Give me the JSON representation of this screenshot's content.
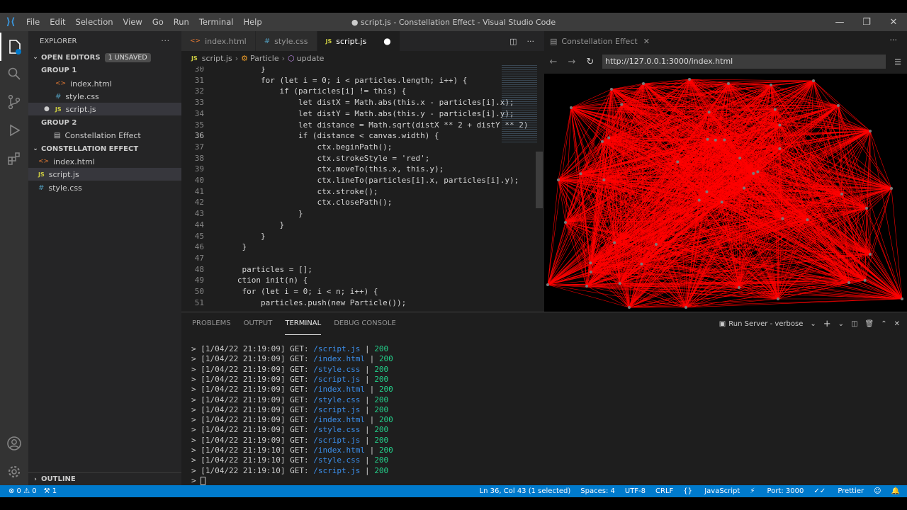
{
  "window": {
    "title": "● script.js - Constellation Effect - Visual Studio Code",
    "menu": [
      "File",
      "Edit",
      "Selection",
      "View",
      "Go",
      "Run",
      "Terminal",
      "Help"
    ]
  },
  "sidebar": {
    "title": "EXPLORER",
    "open_editors": "OPEN EDITORS",
    "unsaved_badge": "1 UNSAVED",
    "group1": "GROUP 1",
    "group1_files": [
      "index.html",
      "style.css",
      "script.js"
    ],
    "group2": "GROUP 2",
    "group2_files": [
      "Constellation Effect"
    ],
    "project": "CONSTELLATION EFFECT",
    "project_files": [
      "index.html",
      "script.js",
      "style.css"
    ],
    "outline": "OUTLINE"
  },
  "editor": {
    "tabs": [
      "index.html",
      "style.css",
      "script.js"
    ],
    "active_tab": "script.js",
    "breadcrumb": [
      "script.js",
      "Particle",
      "update"
    ],
    "lines": [
      {
        "n": "30",
        "t": "        }"
      },
      {
        "n": "31",
        "t": "        for (let i = 0; i < particles.length; i++) {"
      },
      {
        "n": "32",
        "t": "            if (particles[i] != this) {"
      },
      {
        "n": "33",
        "t": "                let distX = Math.abs(this.x - particles[i].x);"
      },
      {
        "n": "34",
        "t": "                let distY = Math.abs(this.y - particles[i].y);"
      },
      {
        "n": "35",
        "t": "                let distance = Math.sqrt(distX ** 2 + distY ** 2)"
      },
      {
        "n": "36",
        "t": "                if (distance < canvas.width) {"
      },
      {
        "n": "37",
        "t": "                    ctx.beginPath();"
      },
      {
        "n": "38",
        "t": "                    ctx.strokeStyle = 'red';"
      },
      {
        "n": "39",
        "t": "                    ctx.moveTo(this.x, this.y);"
      },
      {
        "n": "40",
        "t": "                    ctx.lineTo(particles[i].x, particles[i].y);"
      },
      {
        "n": "41",
        "t": "                    ctx.stroke();"
      },
      {
        "n": "42",
        "t": "                    ctx.closePath();"
      },
      {
        "n": "43",
        "t": "                }"
      },
      {
        "n": "44",
        "t": "            }"
      },
      {
        "n": "45",
        "t": "        }"
      },
      {
        "n": "46",
        "t": "    }"
      },
      {
        "n": "47",
        "t": ""
      },
      {
        "n": "48",
        "t": "    particles = [];"
      },
      {
        "n": "49",
        "t": "   ction init(n) {"
      },
      {
        "n": "50",
        "t": "    for (let i = 0; i < n; i++) {"
      },
      {
        "n": "51",
        "t": "        particles.push(new Particle());"
      }
    ]
  },
  "preview": {
    "tab": "Constellation Effect",
    "url": "http://127.0.0.1:3000/index.html"
  },
  "panel": {
    "tabs": [
      "PROBLEMS",
      "OUTPUT",
      "TERMINAL",
      "DEBUG CONSOLE"
    ],
    "active_tab": "TERMINAL",
    "task": "Run Server - verbose",
    "log": [
      {
        "ts": "[1/04/22 21:19:09] GET: ",
        "path": "/script.js",
        "code": "200"
      },
      {
        "ts": "[1/04/22 21:19:09] GET: ",
        "path": "/index.html",
        "code": "200"
      },
      {
        "ts": "[1/04/22 21:19:09] GET: ",
        "path": "/style.css",
        "code": "200"
      },
      {
        "ts": "[1/04/22 21:19:09] GET: ",
        "path": "/script.js",
        "code": "200"
      },
      {
        "ts": "[1/04/22 21:19:09] GET: ",
        "path": "/index.html",
        "code": "200"
      },
      {
        "ts": "[1/04/22 21:19:09] GET: ",
        "path": "/style.css",
        "code": "200"
      },
      {
        "ts": "[1/04/22 21:19:09] GET: ",
        "path": "/script.js",
        "code": "200"
      },
      {
        "ts": "[1/04/22 21:19:09] GET: ",
        "path": "/index.html",
        "code": "200"
      },
      {
        "ts": "[1/04/22 21:19:09] GET: ",
        "path": "/style.css",
        "code": "200"
      },
      {
        "ts": "[1/04/22 21:19:09] GET: ",
        "path": "/script.js",
        "code": "200"
      },
      {
        "ts": "[1/04/22 21:19:10] GET: ",
        "path": "/index.html",
        "code": "200"
      },
      {
        "ts": "[1/04/22 21:19:10] GET: ",
        "path": "/style.css",
        "code": "200"
      },
      {
        "ts": "[1/04/22 21:19:10] GET: ",
        "path": "/script.js",
        "code": "200"
      }
    ]
  },
  "statusbar": {
    "errors": "⊗ 0 ⚠ 0",
    "ports": "1",
    "cursor": "Ln 36, Col 43 (1 selected)",
    "spaces": "Spaces: 4",
    "encoding": "UTF-8",
    "eol": "CRLF",
    "language": "JavaScript",
    "port": "Port: 3000",
    "prettier": "Prettier"
  },
  "colors": {
    "accent": "#007acc",
    "particles": "#ff0000"
  }
}
